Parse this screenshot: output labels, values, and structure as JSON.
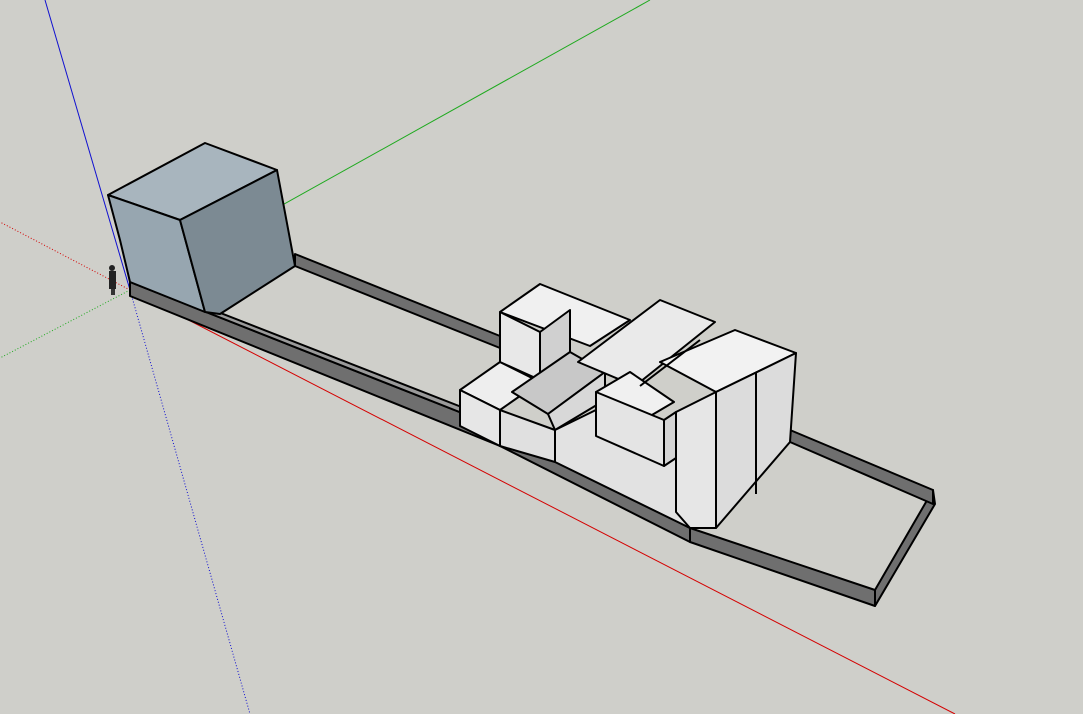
{
  "scene": {
    "background_color": "#cfcfca",
    "axis_colors": {
      "red": "#d40000",
      "green": "#1faa1f",
      "blue": "#1010d0"
    },
    "face_colors": {
      "light": "#e6e6e6",
      "mid": "#d6d6d6",
      "shade": "#c4c4c4",
      "cube_left": "#97a6b0",
      "cube_right": "#7c8a93",
      "wall_side": "#6f6f6f",
      "wall_top": "#9a9a9a"
    },
    "objects": [
      "scale-figure",
      "cube",
      "site-wall",
      "building-mass"
    ]
  }
}
